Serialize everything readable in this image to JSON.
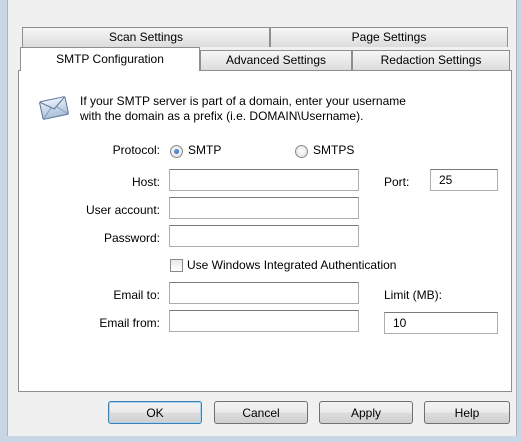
{
  "tabs_row1": [
    {
      "label": "Scan Settings"
    },
    {
      "label": "Page Settings"
    }
  ],
  "tabs_row2": [
    {
      "label": "SMTP Configuration",
      "active": true
    },
    {
      "label": "Advanced Settings"
    },
    {
      "label": "Redaction Settings"
    }
  ],
  "info": {
    "icon": "envelope-icon",
    "line1": "If your SMTP server is part of a domain, enter your username",
    "line2": "with the domain as a prefix (i.e. DOMAIN\\Username)."
  },
  "protocol": {
    "label": "Protocol:",
    "options": [
      "SMTP",
      "SMTPS"
    ],
    "selected": "SMTP"
  },
  "host": {
    "label": "Host:",
    "value": ""
  },
  "port": {
    "label": "Port:",
    "value": "25"
  },
  "user_account": {
    "label": "User account:",
    "value": ""
  },
  "password": {
    "label": "Password:",
    "value": ""
  },
  "windows_auth": {
    "label": "Use Windows Integrated Authentication",
    "checked": false
  },
  "email_to": {
    "label": "Email to:",
    "value": ""
  },
  "limit": {
    "label": "Limit (MB):",
    "value": "10"
  },
  "email_from": {
    "label": "Email from:",
    "value": ""
  },
  "buttons": {
    "ok": "OK",
    "cancel": "Cancel",
    "apply": "Apply",
    "help": "Help"
  },
  "colors": {
    "window_frame": "#c9d6e6",
    "dialog_bg": "#f0f0f0",
    "panel_bg": "#ffffff",
    "default_button_border": "#3c7fb1"
  }
}
